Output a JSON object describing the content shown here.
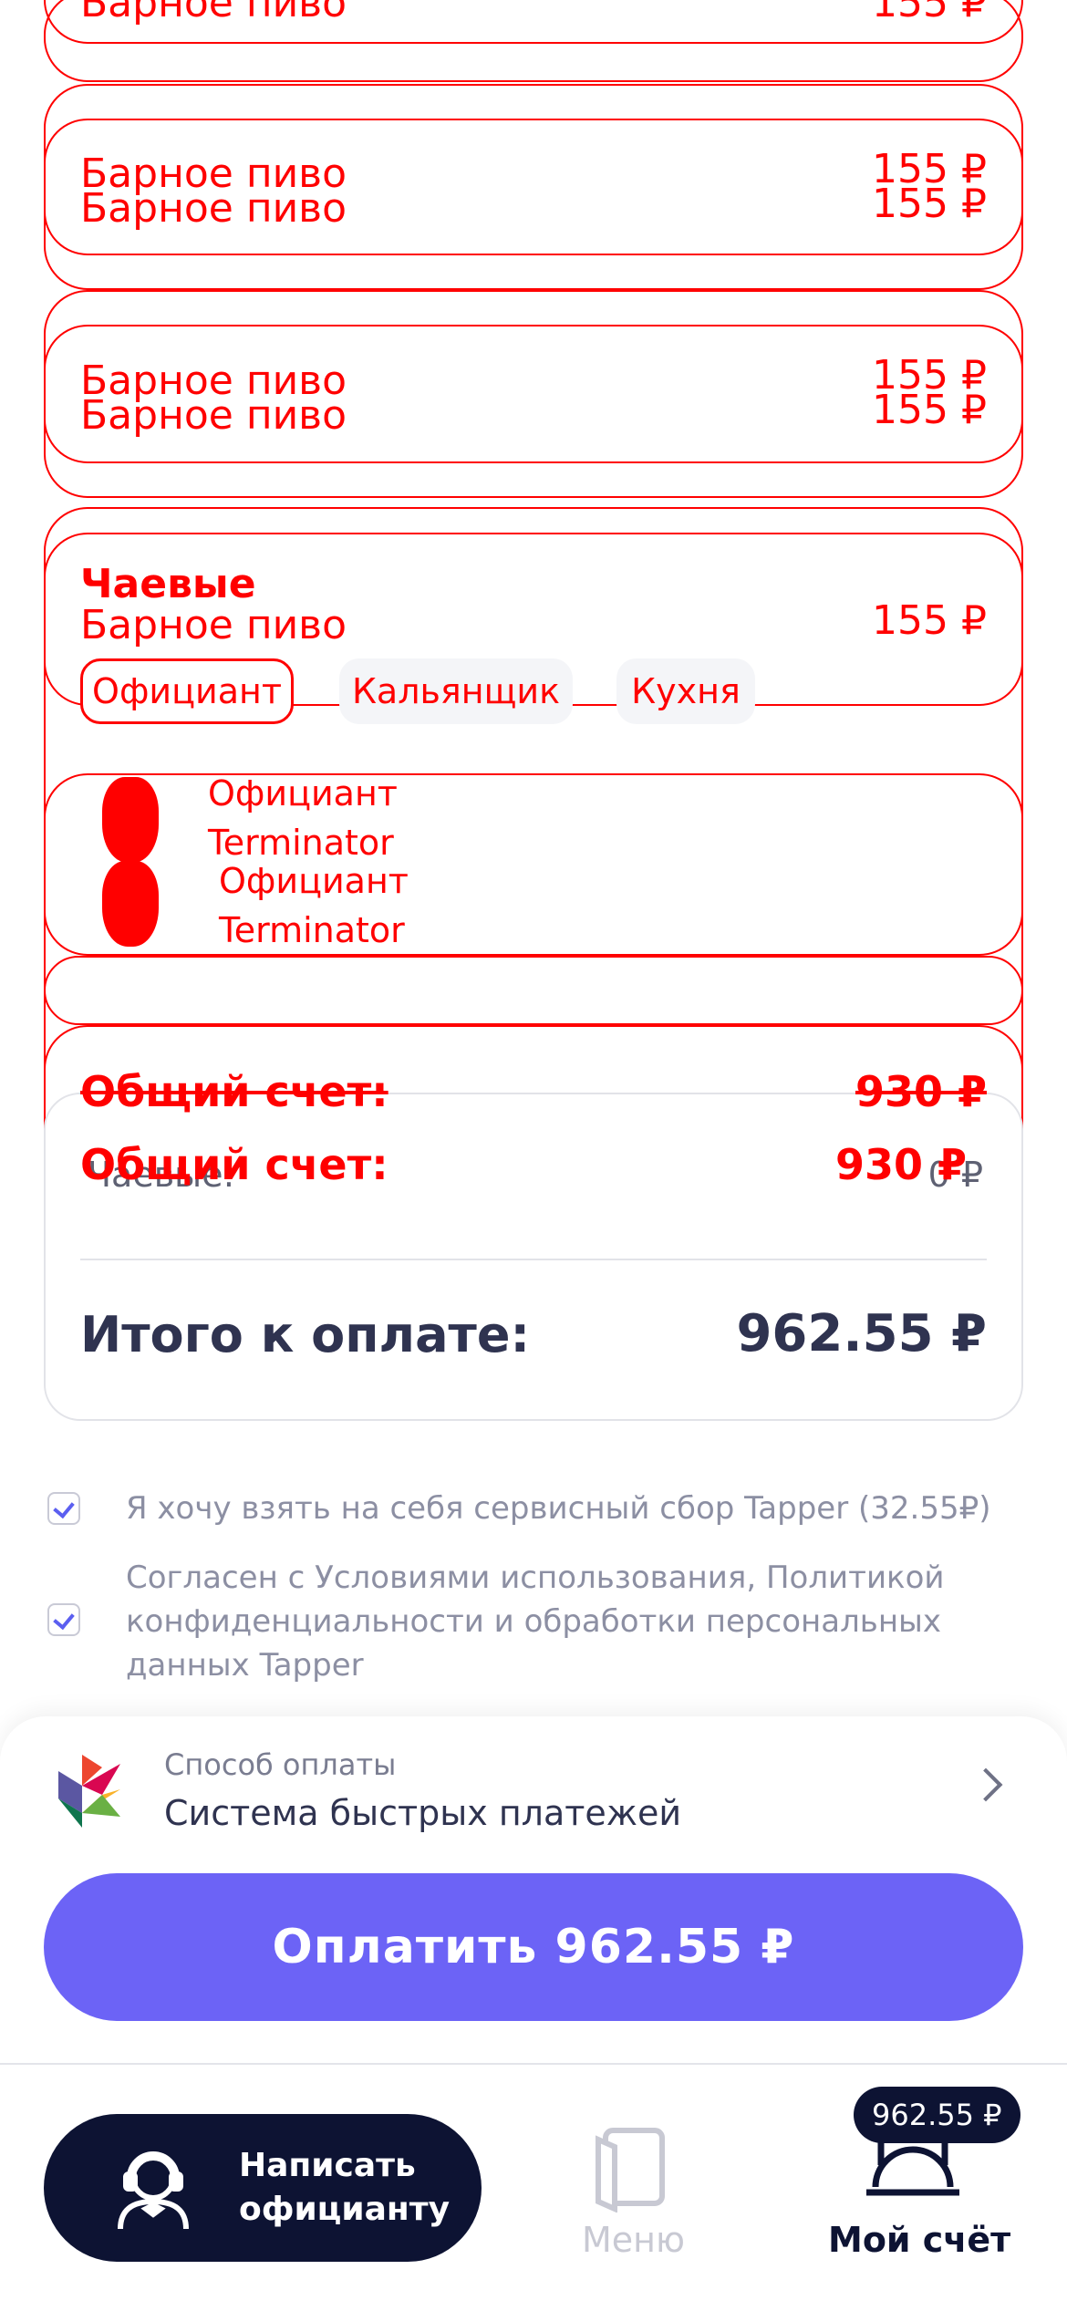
{
  "items": [
    {
      "name": "Барное пиво",
      "price": "155 ₽"
    },
    {
      "name": "Барное пиво",
      "price": "155 ₽"
    },
    {
      "name": "Барное пиво",
      "price": "155 ₽"
    },
    {
      "name": "Барное пиво",
      "price": "155 ₽"
    },
    {
      "name": "Барное пиво",
      "price": "155 ₽"
    },
    {
      "name": "Барное пиво",
      "price": "155 ₽"
    }
  ],
  "tips": {
    "title": "Чаевые",
    "overlap_item": {
      "name": "Барное пиво",
      "price": "155 ₽"
    },
    "tabs": [
      "Официант",
      "Кальянщик",
      "Кухня"
    ],
    "staff": [
      {
        "role": "Официант",
        "name": "Terminator"
      },
      {
        "role": "Официант",
        "name": "Terminator"
      }
    ]
  },
  "summary": {
    "total_label": "Общий счет:",
    "total_value": "930 ₽",
    "total_label_dup": "Общий счет:",
    "total_value_dup": "930 ₽",
    "tips_label": "Чаевые:",
    "tips_value": "0 ₽",
    "to_pay_label": "Итого к оплате:",
    "to_pay_value": "962.55 ₽"
  },
  "consents": [
    {
      "text": "Я хочу взять на себя сервисный сбор Tapper (32.55₽)",
      "checked": true
    },
    {
      "text": "Согласен с Условиями использования, Политикой конфиденциальности и обработки персональных данных Tapper",
      "checked": true
    }
  ],
  "payment": {
    "method_label": "Способ оплаты",
    "method_value": "Система быстрых платежей",
    "pay_button": "Оплатить 962.55 ₽"
  },
  "nav": {
    "chat_line1": "Написать",
    "chat_line2": "официанту",
    "menu_label": "Меню",
    "bill_label": "Мой счёт",
    "bill_badge": "962.55 ₽"
  },
  "colors": {
    "accent": "#6c63f6",
    "dark": "#0d1333",
    "debug_red": "#ff0000"
  }
}
